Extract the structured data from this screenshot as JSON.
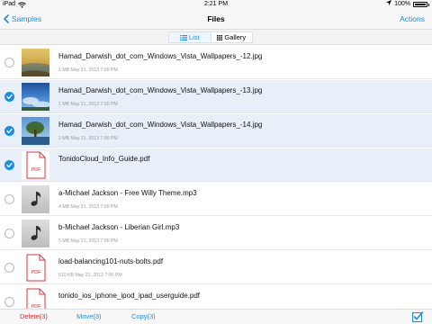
{
  "statusbar": {
    "device": "iPad",
    "time": "2:21 PM",
    "battery": "100%"
  },
  "navbar": {
    "back_label": "Samples",
    "title": "Files",
    "actions_label": "Actions"
  },
  "view_switch": {
    "list_label": "List",
    "gallery_label": "Gallery",
    "active": "List"
  },
  "files": [
    {
      "name": "Hamad_Darwish_dot_com_Windows_Vista_Wallpapers_-12.jpg",
      "meta": "1 MB  May 21, 2013 7:00 PM",
      "selected": false,
      "thumb": "beach-photo"
    },
    {
      "name": "Hamad_Darwish_dot_com_Windows_Vista_Wallpapers_-13.jpg",
      "meta": "1 MB  May 21, 2013 7:00 PM",
      "selected": true,
      "thumb": "sky-photo"
    },
    {
      "name": "Hamad_Darwish_dot_com_Windows_Vista_Wallpapers_-14.jpg",
      "meta": "2 MB  May 21, 2013 7:00 PM",
      "selected": true,
      "thumb": "tree-photo"
    },
    {
      "name": "TonidoCloud_Info_Guide.pdf",
      "meta": "",
      "selected": true,
      "thumb": "pdf"
    },
    {
      "name": "a-Michael Jackson - Free Willy Theme.mp3",
      "meta": "4 MB  May 21, 2013 7:00 PM",
      "selected": false,
      "thumb": "music"
    },
    {
      "name": "b-Michael Jackson - Liberian Girl.mp3",
      "meta": "5 MB  May 21, 2013 7:00 PM",
      "selected": false,
      "thumb": "music"
    },
    {
      "name": "load-balancing101-nuts-bolts.pdf",
      "meta": "510 KB  May 21, 2013 7:00 PM",
      "selected": false,
      "thumb": "pdf"
    },
    {
      "name": "tonido_ios_iphone_ipod_ipad_userguide.pdf",
      "meta": "",
      "selected": false,
      "thumb": "pdf"
    }
  ],
  "pdf_label": "PDF",
  "toolbar": {
    "delete_label": "Delete(3)",
    "move_label": "Move(3)",
    "copy_label": "Copy(3)"
  },
  "colors": {
    "accent": "#1a8fe0",
    "destructive": "#e0262e",
    "selected_row": "#e8eff8",
    "pdf_red": "#d9363e"
  }
}
